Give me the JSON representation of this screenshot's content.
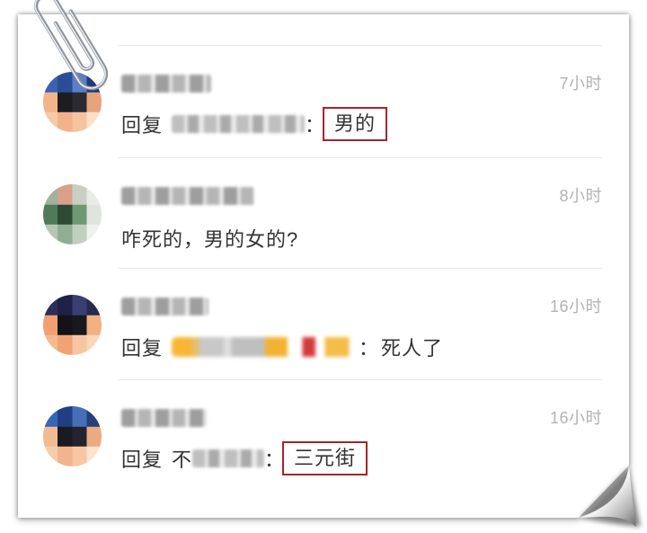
{
  "colors": {
    "text": "#333333",
    "time": "#b3b3b3",
    "divider": "#e8e8e8",
    "highlight": "#a3262a"
  },
  "icons": {
    "paperclip": "paperclip-icon"
  },
  "comments": [
    {
      "time": "7小时",
      "reply_label": "回复",
      "separator": "：",
      "content": "男的"
    },
    {
      "time": "8小时",
      "content": "咋死的，男的女的?"
    },
    {
      "time": "16小时",
      "reply_label": "回复",
      "separator": "：",
      "content": "死人了"
    },
    {
      "time": "16小时",
      "reply_label": "回复",
      "mention_prefix": "不",
      "separator": "：",
      "content": "三元街"
    }
  ]
}
